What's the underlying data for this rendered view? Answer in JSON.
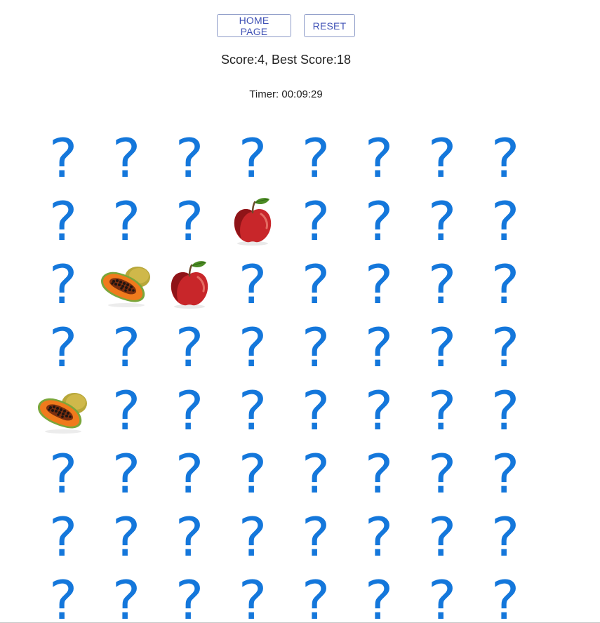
{
  "buttons": {
    "home_label": "HOME PAGE",
    "reset_label": "RESET"
  },
  "score_text": "Score:4, Best Score:18",
  "timer_text": "Timer: 00:09:29",
  "hidden_symbol": "?",
  "colors": {
    "question_mark": "#1477db",
    "button_text": "#3f51b5",
    "button_border": "#8d9bc8"
  },
  "board": {
    "rows": 8,
    "cols": 8,
    "revealed": [
      {
        "row": 1,
        "col": 3,
        "fruit": "apple"
      },
      {
        "row": 2,
        "col": 1,
        "fruit": "papaya"
      },
      {
        "row": 2,
        "col": 2,
        "fruit": "apple"
      },
      {
        "row": 4,
        "col": 0,
        "fruit": "papaya"
      }
    ]
  }
}
